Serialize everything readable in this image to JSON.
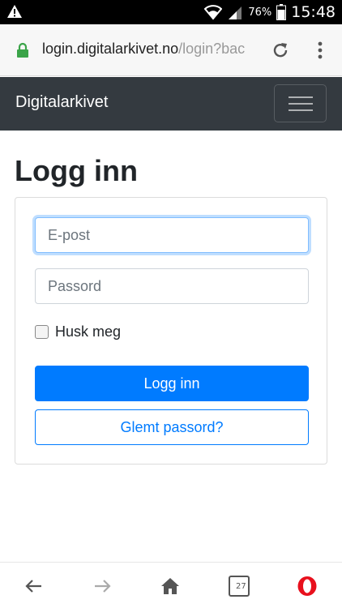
{
  "status_bar": {
    "battery_percent": "76%",
    "time": "15:48"
  },
  "browser": {
    "url_domain": "login.digitalarkivet.no",
    "url_path": "/login?bac",
    "tabs_count": "27"
  },
  "navbar": {
    "brand": "Digitalarkivet"
  },
  "page": {
    "title": "Logg inn"
  },
  "form": {
    "email_placeholder": "E-post",
    "password_placeholder": "Passord",
    "remember_label": "Husk meg",
    "submit_label": "Logg inn",
    "forgot_label": "Glemt passord?"
  },
  "colors": {
    "navbar_bg": "#343a40",
    "primary": "#007bff",
    "lock_green": "#3ba449",
    "opera_red": "#e8101d"
  },
  "icons": [
    "warning-icon",
    "wifi-icon",
    "signal-icon",
    "battery-icon",
    "lock-icon",
    "reload-icon",
    "menu-dots-icon",
    "hamburger-icon",
    "back-arrow-icon",
    "forward-arrow-icon",
    "home-icon",
    "tabs-icon",
    "opera-icon"
  ]
}
